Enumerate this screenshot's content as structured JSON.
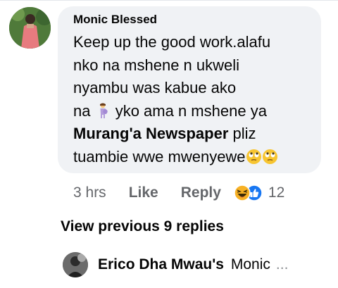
{
  "comment": {
    "author": "Monic Blessed",
    "lines": {
      "l1": "Keep up the good work.alafu",
      "l2": "nko na mshene n ukweli",
      "l3": "nyambu was kabue ako",
      "l4_pre": "na ",
      "l4_post": " yko ama n mshene ya",
      "l5_mention": "Murang'a Newspaper",
      "l5_post": " pliz",
      "l6": "tuambie wwe mwenyewe"
    },
    "emoji": {
      "inline": "pregnant-woman-emoji",
      "trailing": [
        "face-with-rolling-eyes-emoji",
        "face-with-rolling-eyes-emoji"
      ]
    }
  },
  "actions": {
    "time": "3 hrs",
    "like_label": "Like",
    "reply_label": "Reply",
    "reactions": [
      "haha-reaction-icon",
      "like-reaction-icon"
    ],
    "reaction_count": "12"
  },
  "view_previous": "View previous 9 replies",
  "reply_preview": {
    "author": "Erico Dha Mwau's",
    "snippet": "Monic",
    "ellipsis": "..."
  },
  "colors": {
    "bubble_bg": "#f0f2f5",
    "text_primary": "#050505",
    "text_secondary": "#65676b",
    "like_blue": "#1877f2",
    "haha_yellow": "#f7b125"
  }
}
